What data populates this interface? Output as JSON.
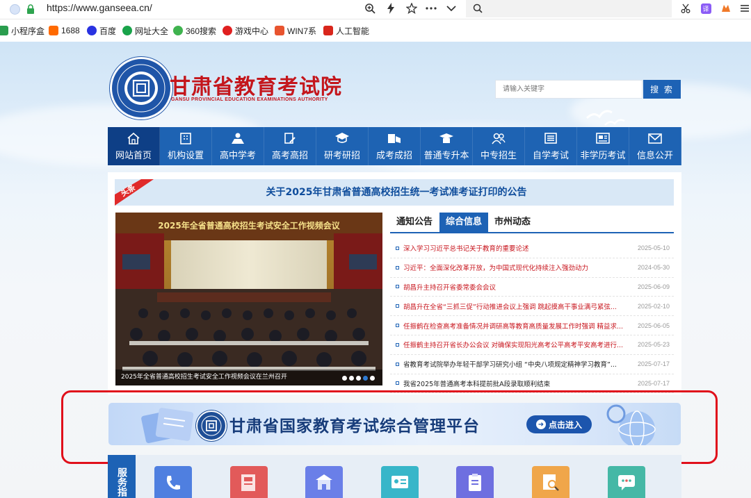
{
  "browser": {
    "url": "https://www.ganseea.cn/",
    "toolbar_icons": [
      "zoom-icon",
      "lightning-icon",
      "star-icon",
      "more-icon",
      "chevron-down-icon"
    ],
    "search_icon": "search-icon",
    "right_icons": [
      "scissors-icon",
      "translate-icon",
      "extension-icon",
      "menu-icon"
    ]
  },
  "bookmarks": [
    {
      "label": "小程序盒",
      "color": "#2a9d4e"
    },
    {
      "label": "1688",
      "color": "#ff6a00"
    },
    {
      "label": "百度",
      "color": "#2932e1"
    },
    {
      "label": "网址大全",
      "color": "#19a34a"
    },
    {
      "label": "360搜索",
      "color": "#3fb34f"
    },
    {
      "label": "游戏中心",
      "color": "#e02020"
    },
    {
      "label": "WIN7系",
      "color": "#e8542f"
    },
    {
      "label": "人工智能",
      "color": "#d9261c"
    }
  ],
  "site": {
    "title": "甘肃省教育考试院",
    "subtitle": "GANSU PROVINCIAL EDUCATION EXAMINATIONS AUTHORITY",
    "search_placeholder": "请输入关键字",
    "search_button": "搜 索",
    "brand_red": "#c4161c",
    "brand_blue": "#1e63b3"
  },
  "nav": [
    {
      "label": "网站首页",
      "icon": "home-icon"
    },
    {
      "label": "机构设置",
      "icon": "building-icon"
    },
    {
      "label": "高中学考",
      "icon": "student-icon"
    },
    {
      "label": "高考高招",
      "icon": "edit-doc-icon"
    },
    {
      "label": "研考研招",
      "icon": "graduation-cap-icon"
    },
    {
      "label": "成考成招",
      "icon": "books-icon"
    },
    {
      "label": "普通专升本",
      "icon": "mortarboard-icon"
    },
    {
      "label": "中专招生",
      "icon": "group-icon"
    },
    {
      "label": "自学考试",
      "icon": "list-doc-icon"
    },
    {
      "label": "非学历考试",
      "icon": "certificate-icon"
    },
    {
      "label": "信息公开",
      "icon": "envelope-icon"
    }
  ],
  "headline": {
    "tag": "头条",
    "text": "关于2025年甘肃省普通高校招生统一考试准考证打印的公告"
  },
  "photo": {
    "banner_text": "2025年全省普通高校招生考试安全工作视频会议",
    "caption": "2025年全省普通高校招生考试安全工作视频会议在兰州召开",
    "slides": 5,
    "active_slide": 4
  },
  "tabs": [
    "通知公告",
    "综合信息",
    "市州动态"
  ],
  "active_tab": 1,
  "news": [
    {
      "title": "深入学习习近平总书记关于教育的重要论述",
      "date": "2025-05-10",
      "red": true
    },
    {
      "title": "习近平：全面深化改革开放，为中国式现代化持续注入强劲动力",
      "date": "2024-05-30",
      "red": true
    },
    {
      "title": "胡昌升主持召开省委常委会会议",
      "date": "2025-06-09",
      "red": true
    },
    {
      "title": "胡昌升在全省“三抓三促”行动推进会议上强调 跳起摸高干事业满弓紧弦...",
      "date": "2025-02-10",
      "red": true
    },
    {
      "title": "任振鹤在检查高考准备情况并调研高等教育高质量发展工作时强调 精益求...",
      "date": "2025-06-05",
      "red": true
    },
    {
      "title": "任振鹤主持召开省长办公会议 对确保实现阳光高考公平高考平安高考进行...",
      "date": "2025-05-23",
      "red": true
    },
    {
      "title": "省教育考试院举办年轻干部学习研究小组 “中央八项规定精神学习教育”...",
      "date": "2025-07-17",
      "red": false
    },
    {
      "title": "我省2025年普通高考本科提前批A段录取顺利结束",
      "date": "2025-07-17",
      "red": false
    }
  ],
  "platform_banner": {
    "text": "甘肃省国家教育考试综合管理平台",
    "button": "点击进入"
  },
  "service": {
    "label": "服务指",
    "tiles": [
      {
        "icon": "phone-icon",
        "color": "#4f7fe0"
      },
      {
        "icon": "score-book-icon",
        "color": "#e25a5a"
      },
      {
        "icon": "school-building-icon",
        "color": "#6a7fe8"
      },
      {
        "icon": "id-card-icon",
        "color": "#38b6c9"
      },
      {
        "icon": "clipboard-icon",
        "color": "#6e6fe0"
      },
      {
        "icon": "magnifier-doc-icon",
        "color": "#f0a64a"
      },
      {
        "icon": "chat-icon",
        "color": "#45b8a6"
      }
    ]
  }
}
